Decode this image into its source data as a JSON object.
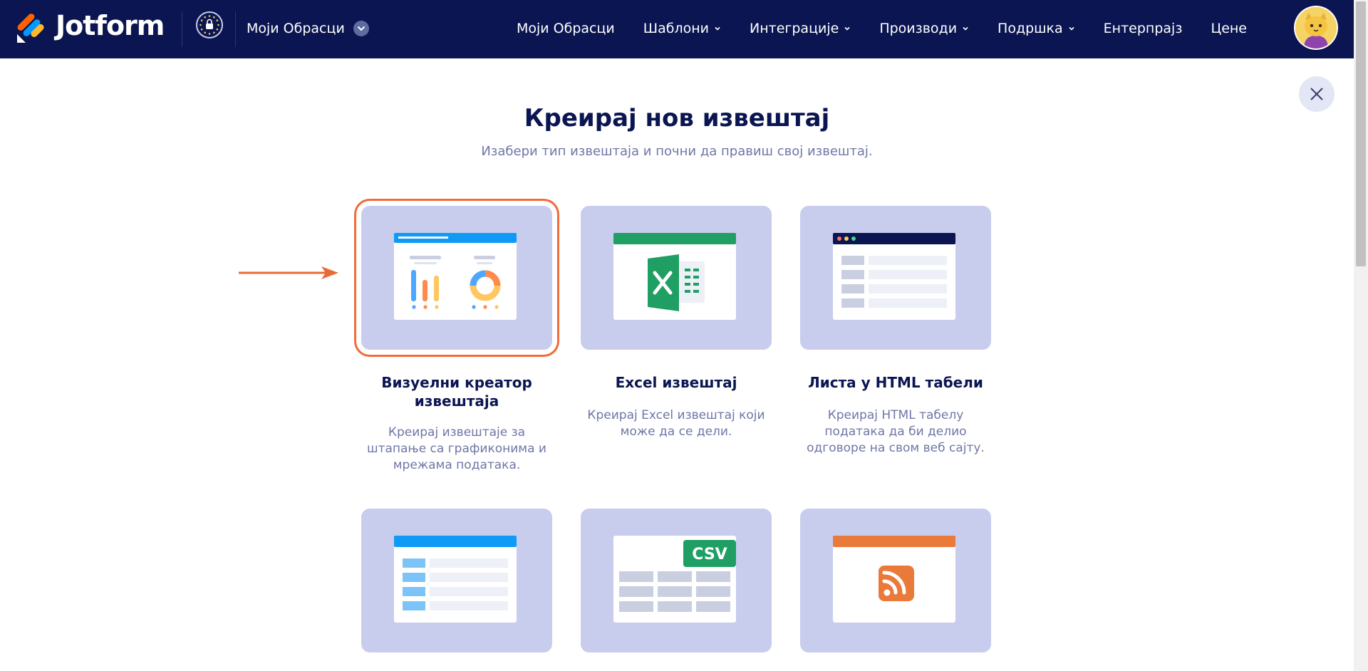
{
  "header": {
    "logo_text": "Jotform",
    "forms_dropdown_label": "Моји Обрасци",
    "nav": [
      {
        "label": "Моји Обрасци",
        "has_caret": false
      },
      {
        "label": "Шаблони",
        "has_caret": true
      },
      {
        "label": "Интеграције",
        "has_caret": true
      },
      {
        "label": "Производи",
        "has_caret": true
      },
      {
        "label": "Подршка",
        "has_caret": true
      },
      {
        "label": "Ентерпрајз",
        "has_caret": false
      },
      {
        "label": "Цене",
        "has_caret": false
      }
    ]
  },
  "page": {
    "title": "Креирај нов извештај",
    "subtitle": "Изабери тип извештаја и почни да правиш свој извештај."
  },
  "cards": [
    {
      "title": "Визуелни креатор извештаја",
      "desc": "Креирај извештаје за штапање са графиконима и мрежама података.",
      "selected": true,
      "icon": "visual-report-icon"
    },
    {
      "title": "Excel извештај",
      "desc": "Креирај Excel извештај који може да се дели.",
      "selected": false,
      "icon": "excel-icon"
    },
    {
      "title": "Листа у HTML табели",
      "desc": "Креирај HTML табелу података да би делио одговоре на свом веб сајту.",
      "selected": false,
      "icon": "html-table-icon"
    },
    {
      "title": "",
      "desc": "",
      "selected": false,
      "icon": "grid-report-icon"
    },
    {
      "title": "",
      "desc": "",
      "selected": false,
      "icon": "csv-icon",
      "badge": "CSV"
    },
    {
      "title": "",
      "desc": "",
      "selected": false,
      "icon": "rss-icon"
    }
  ],
  "colors": {
    "header_bg": "#0a1551",
    "card_bg": "#c8cdee",
    "selected_outline": "#f26b3a",
    "title_text": "#0a1551",
    "muted_text": "#6f76a7",
    "excel_green": "#1f9f63",
    "csv_green": "#1f9f63",
    "rss_orange": "#ea7a3a",
    "blue_accent": "#0f9af5"
  }
}
